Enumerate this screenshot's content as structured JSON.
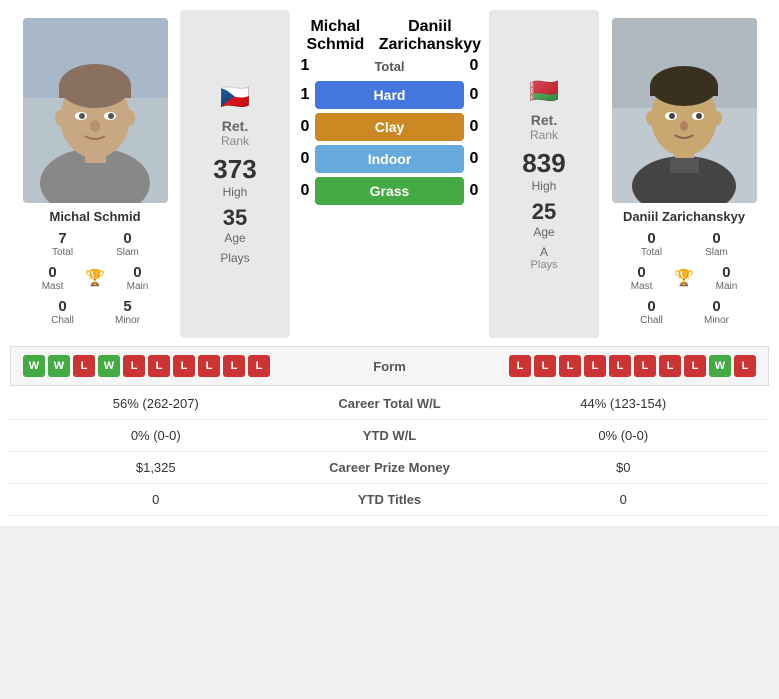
{
  "player1": {
    "name": "Michal Schmid",
    "flag": "🇨🇿",
    "rank_label": "Ret.",
    "rank_sub": "Rank",
    "high": "373",
    "high_label": "High",
    "age": "35",
    "age_label": "Age",
    "plays": "Plays",
    "total": "7",
    "total_label": "Total",
    "slam": "0",
    "slam_label": "Slam",
    "mast": "0",
    "mast_label": "Mast",
    "main": "0",
    "main_label": "Main",
    "chall": "0",
    "chall_label": "Chall",
    "minor": "5",
    "minor_label": "Minor"
  },
  "player2": {
    "name": "Daniil Zarichanskyy",
    "flag": "🇧🇾",
    "rank_label": "Ret.",
    "rank_sub": "Rank",
    "high": "839",
    "high_label": "High",
    "age": "25",
    "age_label": "Age",
    "plays": "A",
    "plays_label": "Plays",
    "total": "0",
    "total_label": "Total",
    "slam": "0",
    "slam_label": "Slam",
    "mast": "0",
    "mast_label": "Mast",
    "main": "0",
    "main_label": "Main",
    "chall": "0",
    "chall_label": "Chall",
    "minor": "0",
    "minor_label": "Minor"
  },
  "surfaces": {
    "total_label": "Total",
    "total_left": "1",
    "total_right": "0",
    "hard_label": "Hard",
    "hard_left": "1",
    "hard_right": "0",
    "clay_label": "Clay",
    "clay_left": "0",
    "clay_right": "0",
    "indoor_label": "Indoor",
    "indoor_left": "0",
    "indoor_right": "0",
    "grass_label": "Grass",
    "grass_left": "0",
    "grass_right": "0"
  },
  "form": {
    "label": "Form",
    "left": [
      "W",
      "W",
      "L",
      "W",
      "L",
      "L",
      "L",
      "L",
      "L",
      "L"
    ],
    "right": [
      "L",
      "L",
      "L",
      "L",
      "L",
      "L",
      "L",
      "L",
      "W",
      "L"
    ]
  },
  "career": {
    "wl_label": "Career Total W/L",
    "wl_left": "56% (262-207)",
    "wl_right": "44% (123-154)",
    "ytd_label": "YTD W/L",
    "ytd_left": "0% (0-0)",
    "ytd_right": "0% (0-0)",
    "prize_label": "Career Prize Money",
    "prize_left": "$1,325",
    "prize_right": "$0",
    "titles_label": "YTD Titles",
    "titles_left": "0",
    "titles_right": "0"
  }
}
